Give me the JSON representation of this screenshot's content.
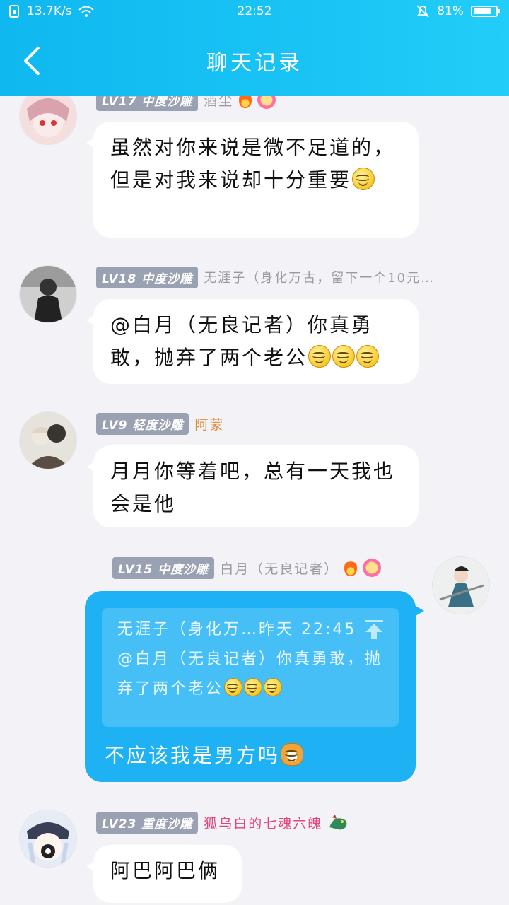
{
  "status_bar": {
    "network_speed": "13.7K/s",
    "time": "22:52",
    "battery_percent": "81%",
    "battery_level": 0.81
  },
  "header": {
    "title": "聊天记录"
  },
  "messages": [
    {
      "level": "LV17 中度沙雕",
      "nick": "酒尘",
      "text": "虽然对你来说是微不足道的，但是对我来说却十分重要"
    },
    {
      "level": "LV18 中度沙雕",
      "nick": "无涯子（身化万古，留下一个10元…",
      "text": "@白月（无良记者）你真勇敢，抛弃了两个老公"
    },
    {
      "level": "LV9 轻度沙雕",
      "nick": "阿蒙",
      "text": "月月你等着吧，总有一天我也会是他"
    },
    {
      "level": "LV15 中度沙雕",
      "nick": "白月（无良记者）",
      "quote_author": "无涯子（身化万…",
      "quote_time": "昨天 22:45",
      "quote_text": "@白月（无良记者）你真勇敢，抛弃了两个老公",
      "text": "不应该我是男方吗"
    },
    {
      "level": "LV23 重度沙雕",
      "nick": "狐乌白的七魂六魄",
      "text": "阿巴阿巴俩"
    }
  ],
  "colors": {
    "header": "#19c4f5",
    "self_bubble": "#1eb1f4",
    "nick_orange": "#e08a3c",
    "nick_pink": "#e2457c"
  }
}
